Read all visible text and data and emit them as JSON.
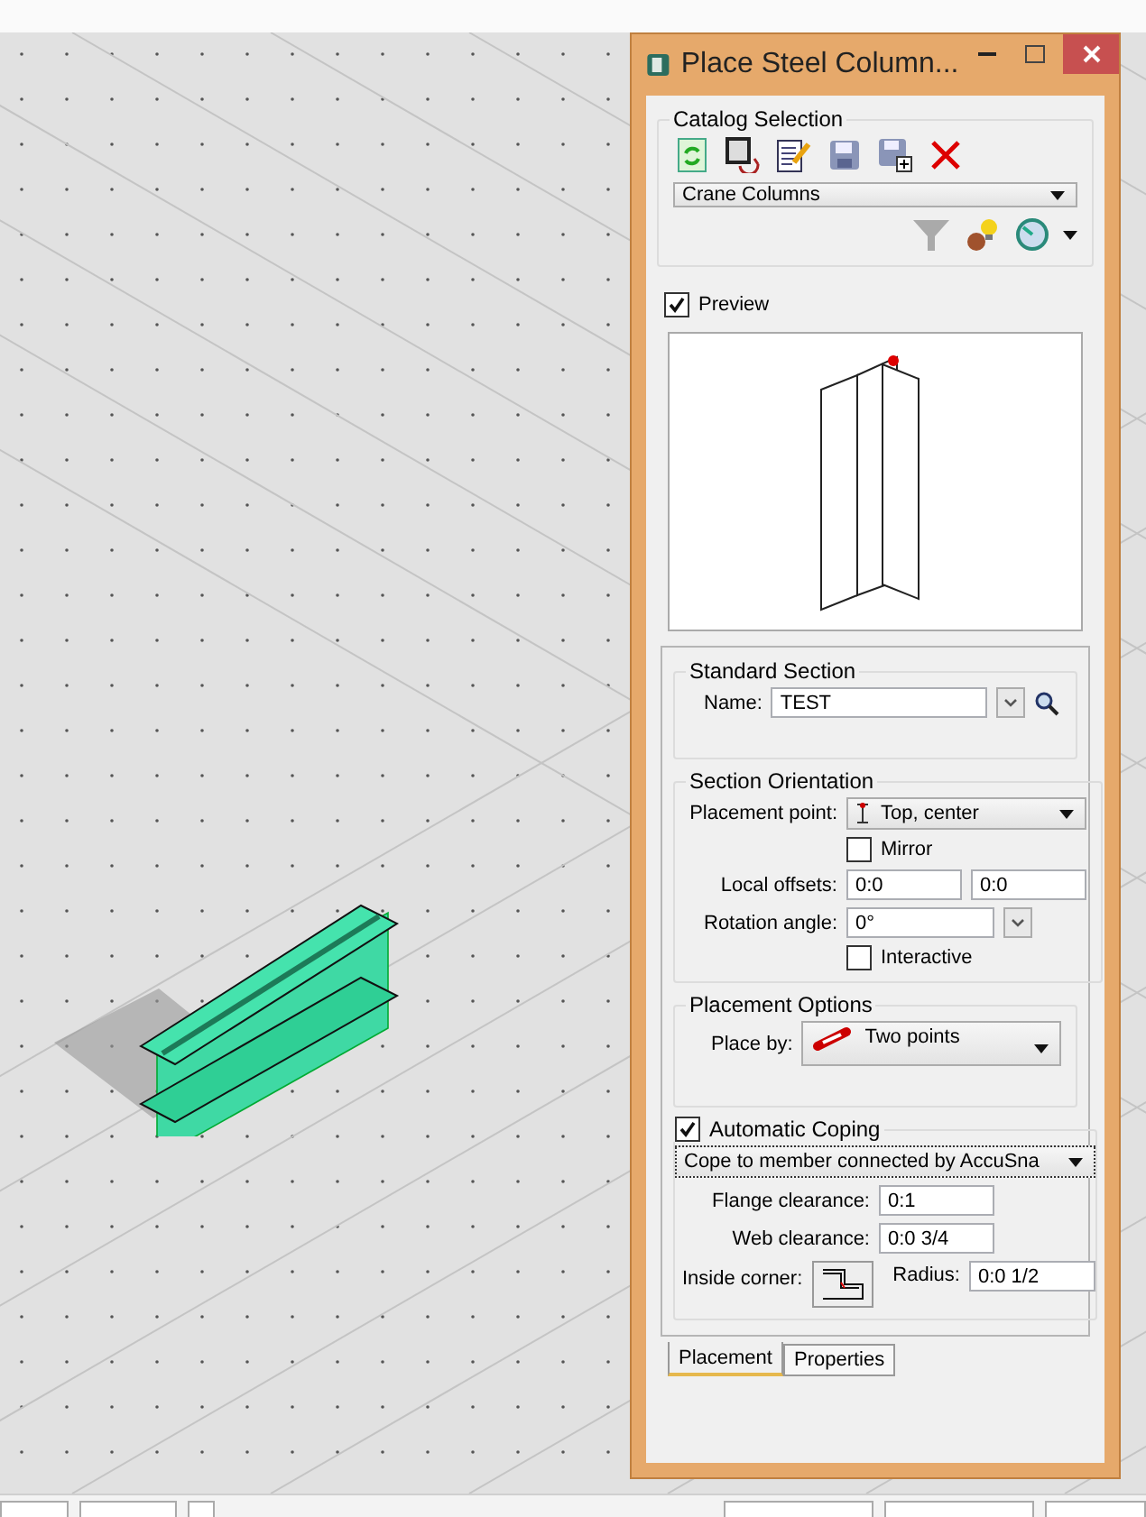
{
  "dialog": {
    "title": "Place Steel Column..."
  },
  "catalog_selection": {
    "title": "Catalog Selection",
    "catalog": "Crane Columns"
  },
  "preview": {
    "label": "Preview",
    "checked": true
  },
  "standard_section": {
    "title": "Standard Section",
    "name_label": "Name:",
    "name_value": "TEST"
  },
  "section_orientation": {
    "title": "Section Orientation",
    "placement_point_label": "Placement point:",
    "placement_point": "Top, center",
    "mirror": {
      "label": "Mirror",
      "checked": false
    },
    "local_offsets_label": "Local offsets:",
    "local_offsets": [
      "0:0",
      "0:0"
    ],
    "rotation_angle_label": "Rotation angle:",
    "rotation_angle": "0°",
    "interactive": {
      "label": "Interactive",
      "checked": false
    }
  },
  "placement_options": {
    "title": "Placement Options",
    "place_by_label": "Place by:",
    "place_by": "Two points"
  },
  "automatic_coping": {
    "label": "Automatic Coping",
    "checked": true,
    "method": "Cope to member connected by AccuSna",
    "flange_clearance_label": "Flange clearance:",
    "flange_clearance": "0:1",
    "web_clearance_label": "Web clearance:",
    "web_clearance": "0:0 3/4",
    "inside_corner_label": "Inside corner:",
    "radius_label": "Radius:",
    "radius": "0:0 1/2"
  },
  "tabs": [
    {
      "label": "Placement",
      "selected": true
    },
    {
      "label": "Properties",
      "selected": false
    }
  ]
}
